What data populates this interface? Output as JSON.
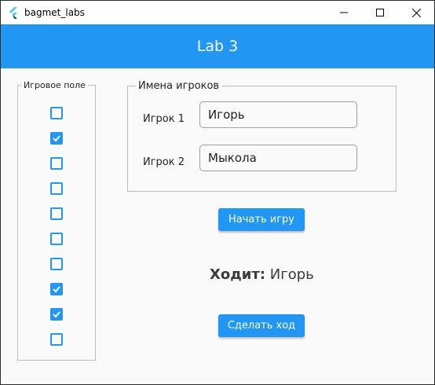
{
  "window": {
    "title": "bagmet_labs",
    "controls": [
      "minimize-icon",
      "maximize-icon",
      "close-icon"
    ]
  },
  "appbar": {
    "title": "Lab 3"
  },
  "game_field": {
    "legend": "Игровое поле",
    "cells": [
      false,
      true,
      false,
      false,
      false,
      false,
      false,
      true,
      true,
      false
    ]
  },
  "players": {
    "legend": "Имена игроков",
    "player1": {
      "label": "Игрок 1",
      "value": "Игорь"
    },
    "player2": {
      "label": "Игрок 2",
      "value": "Мыкола"
    }
  },
  "start_button": {
    "label": "Начать игру"
  },
  "turn": {
    "label": "Ходит:",
    "player": "Игорь"
  },
  "move_button": {
    "label": "Сделать ход"
  },
  "colors": {
    "accent": "#2196f3",
    "background": "#fafafa",
    "border": "#bdbdbd"
  }
}
